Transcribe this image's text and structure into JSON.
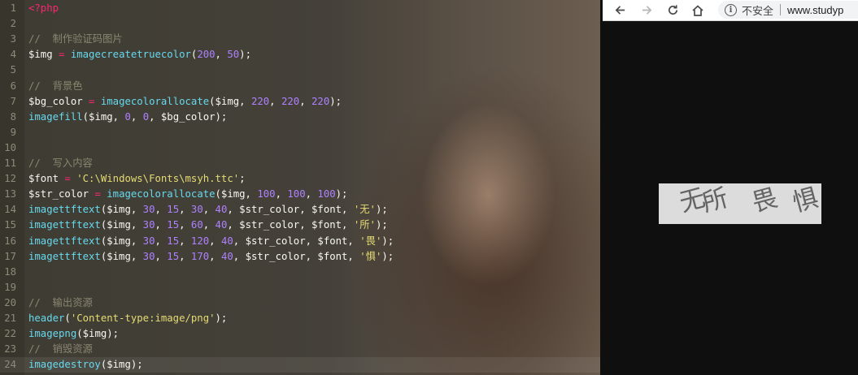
{
  "editor": {
    "lines": [
      {
        "num": "1",
        "tokens": [
          {
            "t": "<?php",
            "c": "kw"
          }
        ]
      },
      {
        "num": "2",
        "tokens": []
      },
      {
        "num": "3",
        "tokens": [
          {
            "t": "//  制作验证码图片",
            "c": "cmt"
          }
        ]
      },
      {
        "num": "4",
        "tokens": [
          {
            "t": "$img",
            "c": "var"
          },
          {
            "t": " = ",
            "c": "op"
          },
          {
            "t": "imagecreatetruecolor",
            "c": "fn"
          },
          {
            "t": "(",
            "c": "pun"
          },
          {
            "t": "200",
            "c": "num"
          },
          {
            "t": ", ",
            "c": "pun"
          },
          {
            "t": "50",
            "c": "num"
          },
          {
            "t": ");",
            "c": "pun"
          }
        ]
      },
      {
        "num": "5",
        "tokens": []
      },
      {
        "num": "6",
        "tokens": [
          {
            "t": "//  背景色",
            "c": "cmt"
          }
        ]
      },
      {
        "num": "7",
        "tokens": [
          {
            "t": "$bg_color",
            "c": "var"
          },
          {
            "t": " = ",
            "c": "op"
          },
          {
            "t": "imagecolorallocate",
            "c": "fn"
          },
          {
            "t": "($img, ",
            "c": "pun"
          },
          {
            "t": "220",
            "c": "num"
          },
          {
            "t": ", ",
            "c": "pun"
          },
          {
            "t": "220",
            "c": "num"
          },
          {
            "t": ", ",
            "c": "pun"
          },
          {
            "t": "220",
            "c": "num"
          },
          {
            "t": ");",
            "c": "pun"
          }
        ]
      },
      {
        "num": "8",
        "tokens": [
          {
            "t": "imagefill",
            "c": "fn"
          },
          {
            "t": "($img, ",
            "c": "pun"
          },
          {
            "t": "0",
            "c": "num"
          },
          {
            "t": ", ",
            "c": "pun"
          },
          {
            "t": "0",
            "c": "num"
          },
          {
            "t": ", $bg_color);",
            "c": "pun"
          }
        ]
      },
      {
        "num": "9",
        "tokens": []
      },
      {
        "num": "10",
        "tokens": []
      },
      {
        "num": "11",
        "tokens": [
          {
            "t": "//  写入内容",
            "c": "cmt"
          }
        ]
      },
      {
        "num": "12",
        "tokens": [
          {
            "t": "$font",
            "c": "var"
          },
          {
            "t": " = ",
            "c": "op"
          },
          {
            "t": "'C:\\Windows\\Fonts\\msyh.ttc'",
            "c": "str"
          },
          {
            "t": ";",
            "c": "pun"
          }
        ]
      },
      {
        "num": "13",
        "tokens": [
          {
            "t": "$str_color",
            "c": "var"
          },
          {
            "t": " = ",
            "c": "op"
          },
          {
            "t": "imagecolorallocate",
            "c": "fn"
          },
          {
            "t": "($img, ",
            "c": "pun"
          },
          {
            "t": "100",
            "c": "num"
          },
          {
            "t": ", ",
            "c": "pun"
          },
          {
            "t": "100",
            "c": "num"
          },
          {
            "t": ", ",
            "c": "pun"
          },
          {
            "t": "100",
            "c": "num"
          },
          {
            "t": ");",
            "c": "pun"
          }
        ]
      },
      {
        "num": "14",
        "tokens": [
          {
            "t": "imagettftext",
            "c": "fn"
          },
          {
            "t": "($img, ",
            "c": "pun"
          },
          {
            "t": "30",
            "c": "num"
          },
          {
            "t": ", ",
            "c": "pun"
          },
          {
            "t": "15",
            "c": "num"
          },
          {
            "t": ", ",
            "c": "pun"
          },
          {
            "t": "30",
            "c": "num"
          },
          {
            "t": ", ",
            "c": "pun"
          },
          {
            "t": "40",
            "c": "num"
          },
          {
            "t": ", $str_color, $font, ",
            "c": "pun"
          },
          {
            "t": "'无'",
            "c": "str"
          },
          {
            "t": ");",
            "c": "pun"
          }
        ]
      },
      {
        "num": "15",
        "tokens": [
          {
            "t": "imagettftext",
            "c": "fn"
          },
          {
            "t": "($img, ",
            "c": "pun"
          },
          {
            "t": "30",
            "c": "num"
          },
          {
            "t": ", ",
            "c": "pun"
          },
          {
            "t": "15",
            "c": "num"
          },
          {
            "t": ", ",
            "c": "pun"
          },
          {
            "t": "60",
            "c": "num"
          },
          {
            "t": ", ",
            "c": "pun"
          },
          {
            "t": "40",
            "c": "num"
          },
          {
            "t": ", $str_color, $font, ",
            "c": "pun"
          },
          {
            "t": "'所'",
            "c": "str"
          },
          {
            "t": ");",
            "c": "pun"
          }
        ]
      },
      {
        "num": "16",
        "tokens": [
          {
            "t": "imagettftext",
            "c": "fn"
          },
          {
            "t": "($img, ",
            "c": "pun"
          },
          {
            "t": "30",
            "c": "num"
          },
          {
            "t": ", ",
            "c": "pun"
          },
          {
            "t": "15",
            "c": "num"
          },
          {
            "t": ", ",
            "c": "pun"
          },
          {
            "t": "120",
            "c": "num"
          },
          {
            "t": ", ",
            "c": "pun"
          },
          {
            "t": "40",
            "c": "num"
          },
          {
            "t": ", $str_color, $font, ",
            "c": "pun"
          },
          {
            "t": "'畏'",
            "c": "str"
          },
          {
            "t": ");",
            "c": "pun"
          }
        ]
      },
      {
        "num": "17",
        "tokens": [
          {
            "t": "imagettftext",
            "c": "fn"
          },
          {
            "t": "($img, ",
            "c": "pun"
          },
          {
            "t": "30",
            "c": "num"
          },
          {
            "t": ", ",
            "c": "pun"
          },
          {
            "t": "15",
            "c": "num"
          },
          {
            "t": ", ",
            "c": "pun"
          },
          {
            "t": "170",
            "c": "num"
          },
          {
            "t": ", ",
            "c": "pun"
          },
          {
            "t": "40",
            "c": "num"
          },
          {
            "t": ", $str_color, $font, ",
            "c": "pun"
          },
          {
            "t": "'惧'",
            "c": "str"
          },
          {
            "t": ");",
            "c": "pun"
          }
        ]
      },
      {
        "num": "18",
        "tokens": []
      },
      {
        "num": "19",
        "tokens": []
      },
      {
        "num": "20",
        "tokens": [
          {
            "t": "//  输出资源",
            "c": "cmt"
          }
        ]
      },
      {
        "num": "21",
        "tokens": [
          {
            "t": "header",
            "c": "fn"
          },
          {
            "t": "(",
            "c": "pun"
          },
          {
            "t": "'Content-type:image/png'",
            "c": "str"
          },
          {
            "t": ");",
            "c": "pun"
          }
        ]
      },
      {
        "num": "22",
        "tokens": [
          {
            "t": "imagepng",
            "c": "fn"
          },
          {
            "t": "($img);",
            "c": "pun"
          }
        ]
      },
      {
        "num": "23",
        "tokens": [
          {
            "t": "//  销毁资源",
            "c": "cmt"
          }
        ]
      },
      {
        "num": "24",
        "tokens": [
          {
            "t": "imagedestroy",
            "c": "fn"
          },
          {
            "t": "($img);",
            "c": "pun"
          }
        ],
        "active": true
      }
    ]
  },
  "browser": {
    "back_icon": "back-arrow-icon",
    "forward_icon": "forward-arrow-icon",
    "reload_icon": "reload-icon",
    "home_icon": "home-icon",
    "security_label": "不安全",
    "url": "www.studyp"
  },
  "captcha": {
    "background": "#dcdcdc",
    "text_color": "#646464",
    "chars": [
      "无",
      "所",
      "畏",
      "惧"
    ]
  },
  "colors": {
    "keyword": "#f92672",
    "function": "#66d9ef",
    "number": "#ae81ff",
    "string": "#e6db74",
    "comment": "#8a8670"
  }
}
